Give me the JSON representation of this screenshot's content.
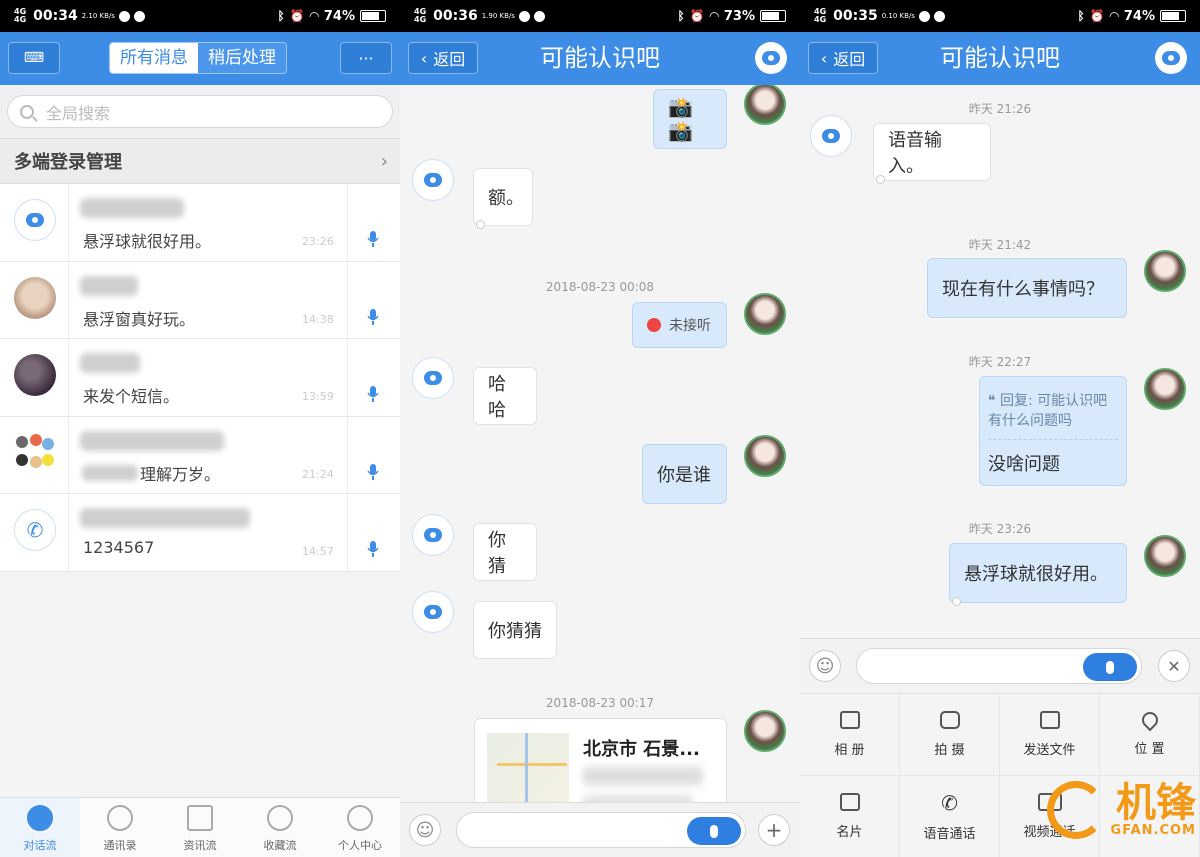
{
  "panels": {
    "p1": {
      "status": {
        "time": "00:34",
        "speed": "2.10 KB/s",
        "battery": "74%"
      },
      "header": {
        "seg_all": "所有消息",
        "seg_later": "稍后处理",
        "more": "···"
      },
      "search_placeholder": "全局搜索",
      "multi_login": "多端登录管理",
      "conversations": [
        {
          "preview": "悬浮球就很好用。",
          "time": "23:26"
        },
        {
          "preview": "悬浮窗真好玩。",
          "time": "14:38"
        },
        {
          "preview": "来发个短信。",
          "time": "13:59"
        },
        {
          "preview": "理解万岁。",
          "time": "21:24"
        },
        {
          "preview": "1234567",
          "time": "14:57"
        }
      ],
      "tabs": [
        "对话流",
        "通讯录",
        "资讯流",
        "收藏流",
        "个人中心"
      ]
    },
    "p2": {
      "status": {
        "time": "00:36",
        "speed": "1.90 KB/s",
        "battery": "73%"
      },
      "back": "返回",
      "title": "可能认识吧",
      "msgs": {
        "cam": "📸📸",
        "e": "额。",
        "date1": "2018-08-23 00:08",
        "missed": "未接听",
        "haha": "哈哈",
        "who": "你是谁",
        "guess": "你猜",
        "guessguess": "你猜猜",
        "date2": "2018-08-23 00:17",
        "location": "北京市 石景..."
      }
    },
    "p3": {
      "status": {
        "time": "00:35",
        "speed": "0.10 KB/s",
        "battery": "74%"
      },
      "back": "返回",
      "title": "可能认识吧",
      "msgs": {
        "t1": "昨天 21:26",
        "voice": "语音输入。",
        "t2": "昨天 21:42",
        "what": "现在有什么事情吗？",
        "t3": "昨天 22:27",
        "reply_head": "回复: 可能认识吧",
        "reply_orig": "有什么问题吗",
        "reply_body": "没啥问题",
        "t4": "昨天 23:26",
        "float": "悬浮球就很好用。"
      },
      "attachments": [
        "相 册",
        "拍 摄",
        "发送文件",
        "位 置",
        "名片",
        "语音通话",
        "视频通话",
        ""
      ]
    }
  },
  "watermark": {
    "cn": "机锋",
    "en": "GFAN.COM"
  },
  "colors": {
    "primary": "#3d8ce6",
    "bubble_out": "#d7e9fb",
    "watermark": "#f29a17"
  }
}
